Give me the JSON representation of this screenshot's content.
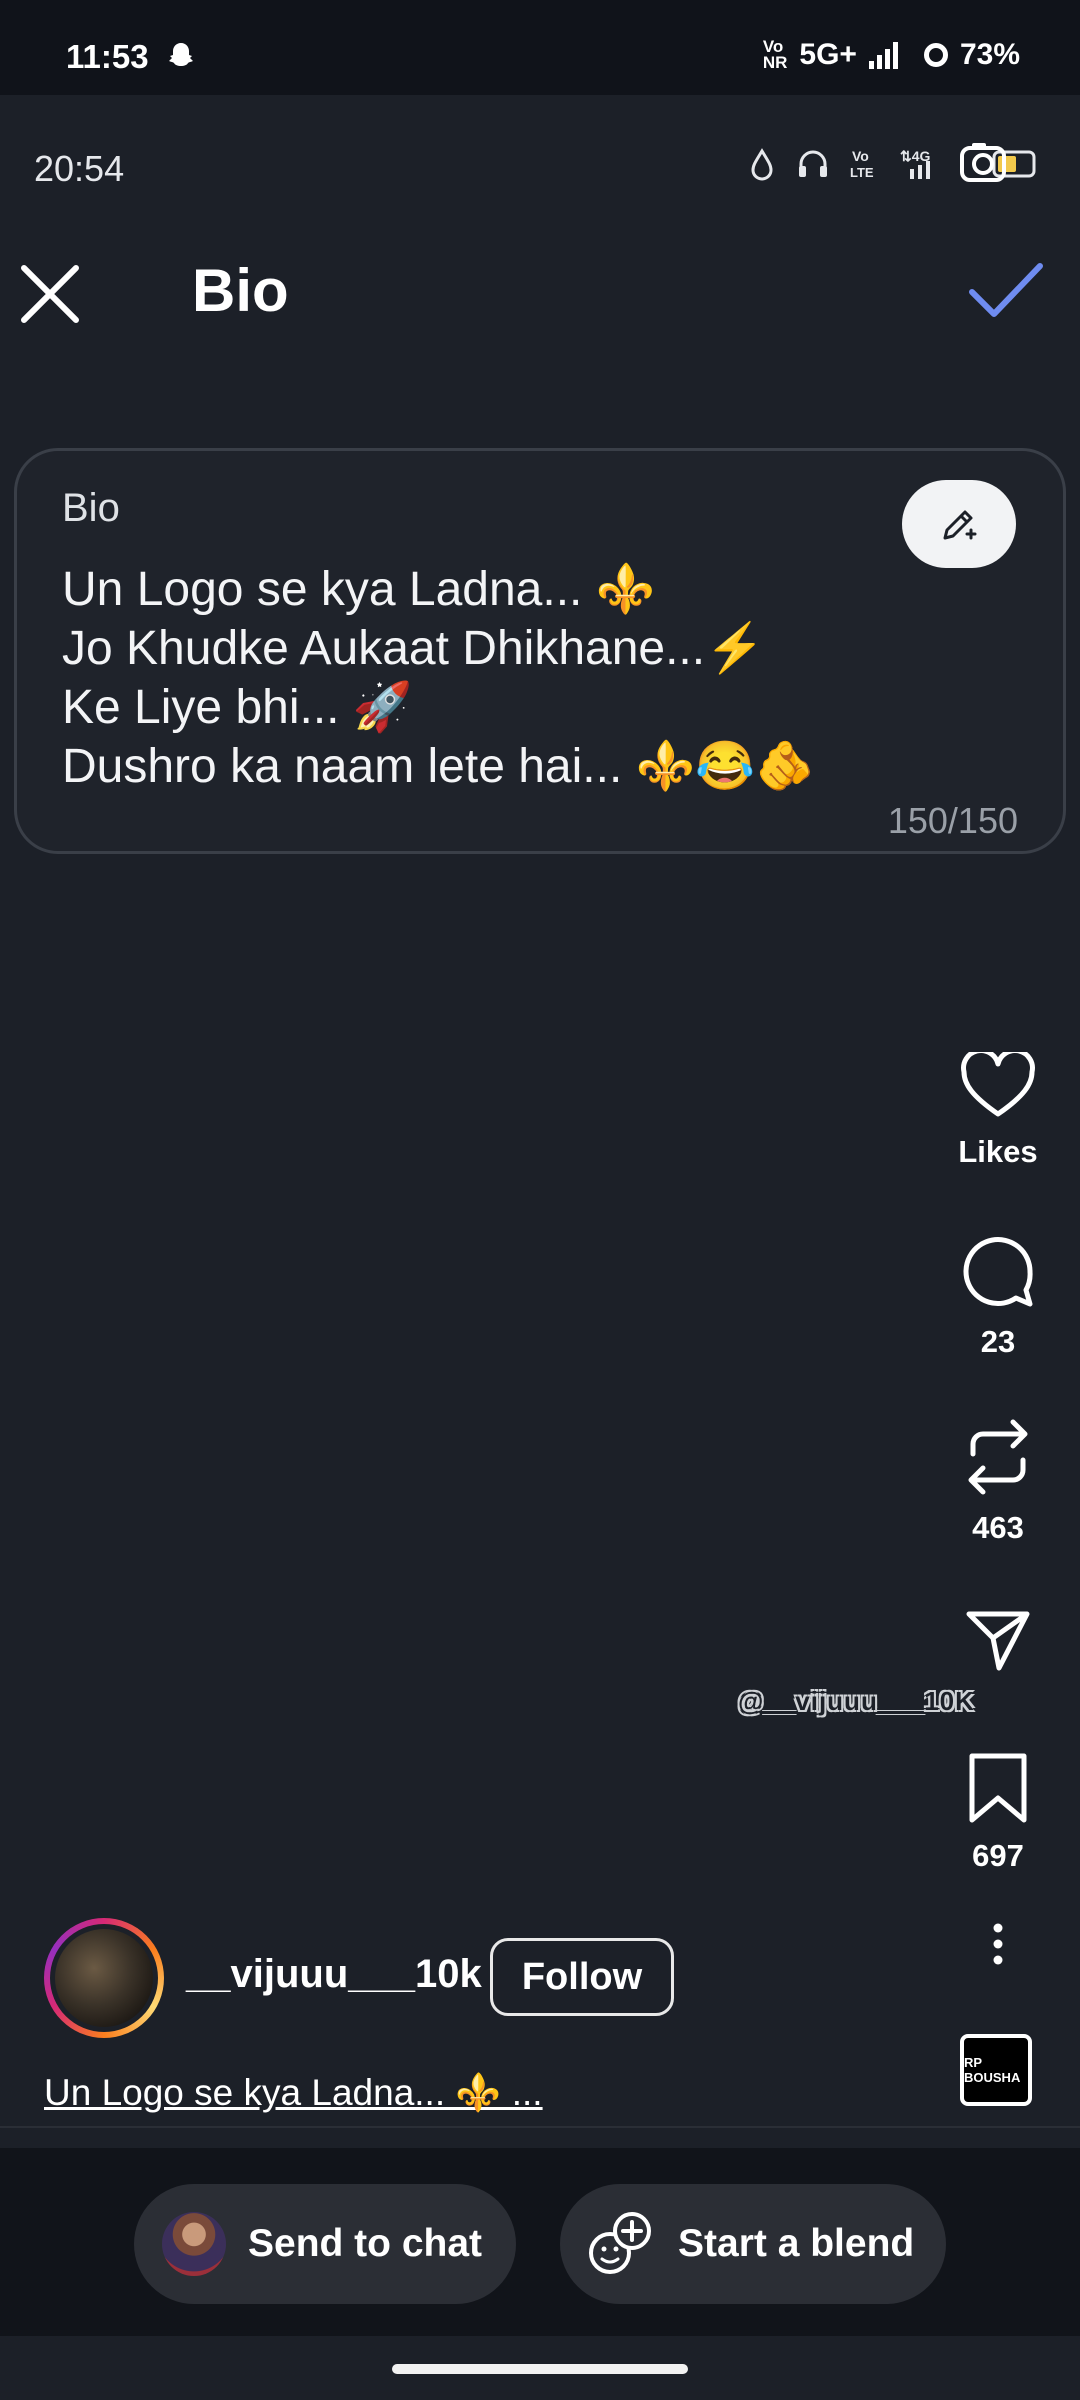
{
  "status_bar": {
    "time": "11:53",
    "network": "5G+",
    "volte": "Vo\nNR",
    "battery": "73%"
  },
  "inner_status": {
    "time": "20:54"
  },
  "header": {
    "title": "Bio"
  },
  "bio": {
    "label": "Bio",
    "text": "Un Logo se kya Ladna... ⚜️\nJo Khudke Aukaat Dhikhane...⚡\nKe Liye bhi... 🚀\nDushro ka naam lete hai... ⚜️😂🫵",
    "counter": "150/150"
  },
  "actions": {
    "likes_label": "Likes",
    "comments_count": "23",
    "reposts_count": "463",
    "saves_count": "697"
  },
  "watermark": "@__vijuuu___10K",
  "author": {
    "username": "__vijuuu___10k",
    "follow_label": "Follow",
    "caption": "Un Logo se kya Ladna... ⚜️ ..."
  },
  "audio": {
    "thumb_text": "RP BOUSHA"
  },
  "bottom": {
    "send_label": "Send to chat",
    "blend_label": "Start a blend"
  },
  "colors": {
    "background": "#1c2028",
    "accent_check": "#6f8cf0",
    "pill": "#2b2e35"
  }
}
